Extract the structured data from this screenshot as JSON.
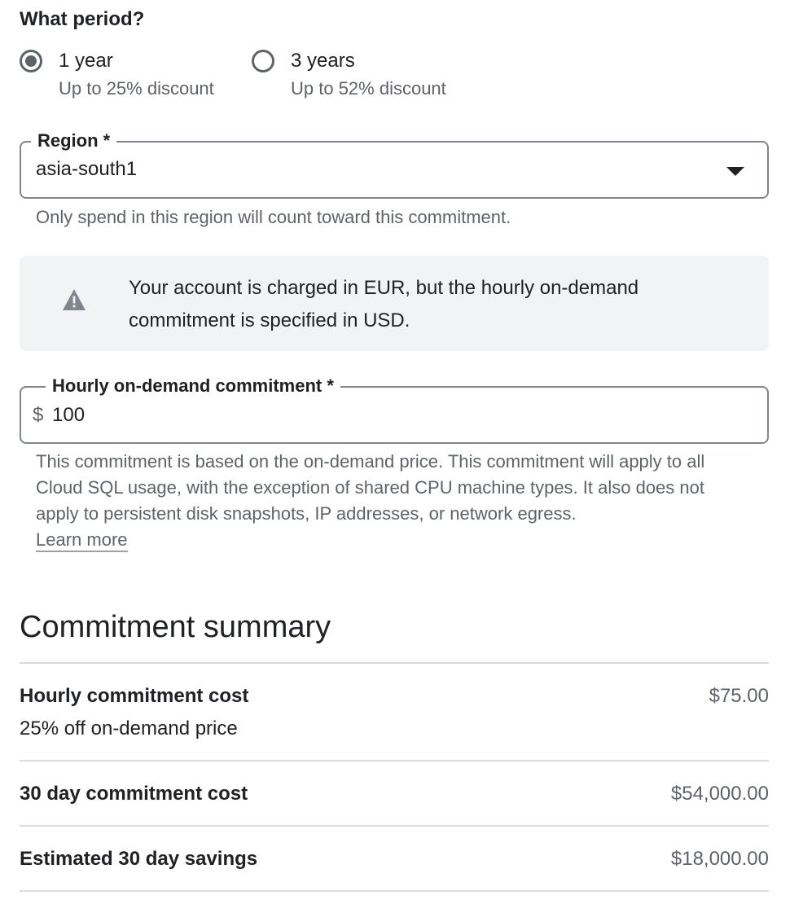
{
  "period": {
    "title": "What period?",
    "options": [
      {
        "label": "1 year",
        "sub": "Up to 25% discount",
        "checked": true
      },
      {
        "label": "3 years",
        "sub": "Up to 52% discount",
        "checked": false
      }
    ]
  },
  "region": {
    "label": "Region *",
    "value": "asia-south1",
    "helper": "Only spend in this region will count toward this commitment."
  },
  "warning": {
    "icon": "warning-icon",
    "text": "Your account is charged in EUR, but the hourly on-demand commitment is specified in USD."
  },
  "commitment": {
    "label": "Hourly on-demand commitment *",
    "currency": "$",
    "value": "100",
    "description": "This commitment is based on the on-demand price. This commitment will apply to all Cloud SQL usage, with the exception of shared CPU machine types. It also does not apply to persistent disk snapshots, IP addresses, or network egress.",
    "learn_more": "Learn more"
  },
  "summary": {
    "title": "Commitment summary",
    "rows": [
      {
        "label": "Hourly commitment cost",
        "sub": "25% off on-demand price",
        "value": "$75.00"
      },
      {
        "label": "30 day commitment cost",
        "value": "$54,000.00"
      },
      {
        "label": "Estimated 30 day savings",
        "value": "$18,000.00"
      }
    ]
  }
}
